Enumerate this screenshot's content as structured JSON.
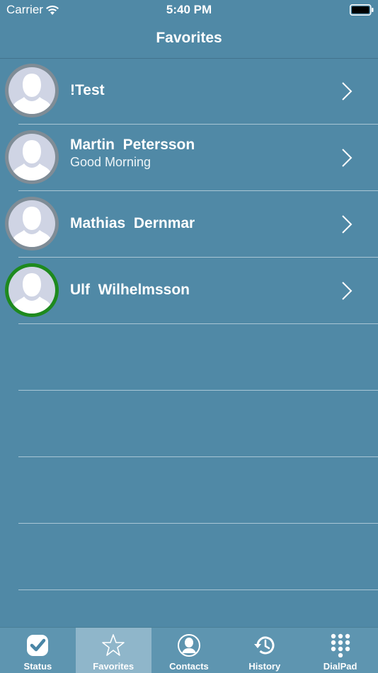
{
  "status_bar": {
    "carrier": "Carrier",
    "time": "5:40 PM",
    "wifi_icon": "wifi-icon",
    "battery_icon": "battery-icon"
  },
  "nav": {
    "title": "Favorites"
  },
  "colors": {
    "background": "#5089a6",
    "tab_bar": "#5e95b0",
    "tab_active": "#8fb6ca",
    "online_ring": "#1e8a1e",
    "offline_ring": "#7f8c96",
    "avatar_fill": "#cfd4e4"
  },
  "favorites": [
    {
      "name": "!Test",
      "subtitle": "",
      "status": "offline"
    },
    {
      "name": "Martin  Petersson",
      "subtitle": "Good Morning",
      "status": "offline"
    },
    {
      "name": "Mathias  Dernmar",
      "subtitle": "",
      "status": "offline"
    },
    {
      "name": "Ulf  Wilhelmsson",
      "subtitle": "",
      "status": "online"
    }
  ],
  "tabs": [
    {
      "label": "Status",
      "icon": "status-check-icon",
      "active": false
    },
    {
      "label": "Favorites",
      "icon": "star-icon",
      "active": true
    },
    {
      "label": "Contacts",
      "icon": "contact-person-icon",
      "active": false
    },
    {
      "label": "History",
      "icon": "history-clock-icon",
      "active": false
    },
    {
      "label": "DialPad",
      "icon": "dialpad-icon",
      "active": false
    }
  ]
}
